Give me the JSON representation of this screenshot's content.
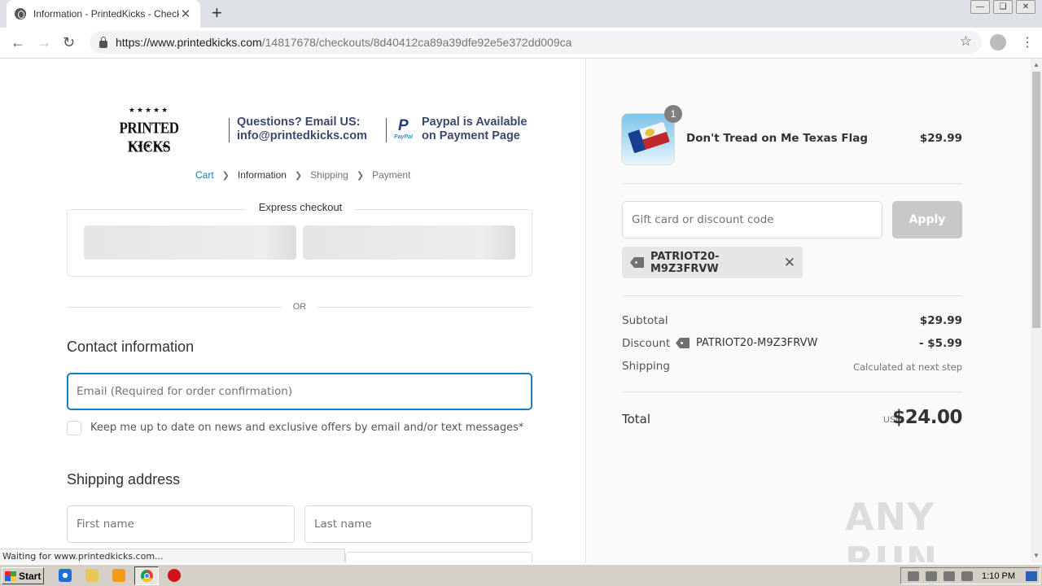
{
  "browser": {
    "tab_title": "Information - PrintedKicks - Checkout",
    "tab_close": "✕",
    "new_tab": "+",
    "url_host": "https://www.printedkicks.com",
    "url_path": "/14817678/checkouts/8d40412ca89a39dfe92e5e372dd009ca",
    "status_text": "Waiting for www.printedkicks.com..."
  },
  "header": {
    "brand": "PRINTED KICKS",
    "questions_line1": "Questions? Email US:",
    "questions_line2": "info@printedkicks.com",
    "paypal_line1": "Paypal is Available",
    "paypal_line2": "on Payment Page",
    "paypal_small": "PayPal"
  },
  "breadcrumb": {
    "cart": "Cart",
    "information": "Information",
    "shipping": "Shipping",
    "payment": "Payment"
  },
  "express": {
    "title": "Express checkout",
    "or": "OR"
  },
  "contact": {
    "title": "Contact information",
    "email_placeholder": "Email (Required for order confirmation)",
    "newsletter_label": "Keep me up to date on news and exclusive offers by email and/or text messages*"
  },
  "shipping": {
    "title": "Shipping address",
    "first_name_placeholder": "First name",
    "last_name_placeholder": "Last name"
  },
  "order": {
    "quantity": "1",
    "product_name": "Don't Tread on Me Texas Flag",
    "product_price": "$29.99",
    "discount_placeholder": "Gift card or discount code",
    "apply_label": "Apply",
    "applied_code": "PATRIOT20-M9Z3FRVW",
    "subtotal_label": "Subtotal",
    "subtotal_value": "$29.99",
    "discount_label": "Discount",
    "discount_code": "PATRIOT20-M9Z3FRVW",
    "discount_value": "- $5.99",
    "shipping_label": "Shipping",
    "shipping_value": "Calculated at next step",
    "total_label": "Total",
    "currency": "USD",
    "total_value": "$24.00"
  },
  "watermark": "ANY RUN",
  "taskbar": {
    "start_label": "Start",
    "clock": "1:10 PM"
  },
  "colors": {
    "accent": "#197bbd",
    "header_text": "#3a4a6a",
    "apply_disabled": "#c8c8c8"
  }
}
